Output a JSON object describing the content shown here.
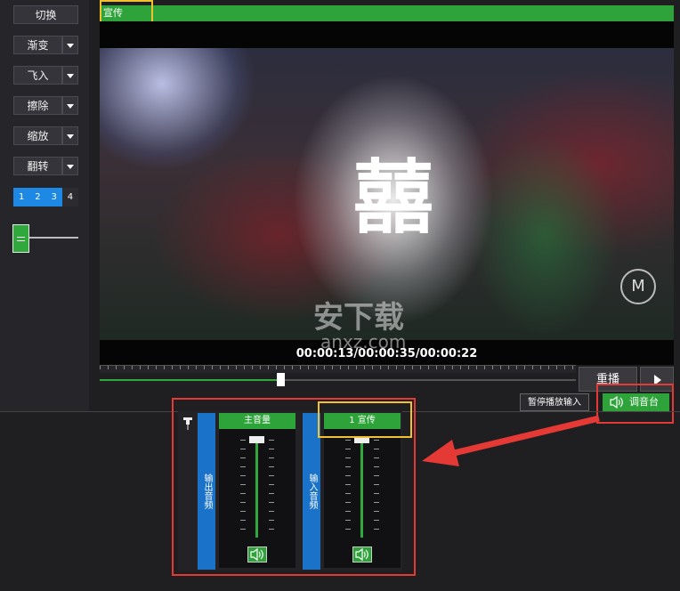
{
  "left_toolbar": {
    "switch_label": "切换",
    "fade_label": "渐变",
    "fly_in_label": "飞入",
    "wipe_label": "擦除",
    "zoom_label": "缩放",
    "flip_label": "翻转",
    "layers": [
      "1",
      "2",
      "3",
      "4"
    ],
    "fader_icon": "equals-icon"
  },
  "preview": {
    "channel_name": "宣传",
    "timecode": "00:00:13/00:00:35/00:00:22",
    "progress_fraction": 0.38,
    "watermark_brand": "M",
    "watermark_site": "安下载",
    "watermark_url": "anxz.com",
    "glyph": "囍"
  },
  "controls": {
    "replay_label": "重播",
    "play_icon": "play-icon",
    "pause_input_label": "暂停播放输入",
    "mixer_label": "调音台",
    "mixer_icon": "speaker-icon"
  },
  "mixer": {
    "output_label": "输出音频",
    "input_label": "输入音频",
    "master_label": "主音量",
    "input_channel_label": "1  宣传",
    "pin_icon": "pin-icon"
  },
  "colors": {
    "accent_green": "#2ea33a",
    "accent_blue": "#1a73c9",
    "highlight_red": "#e53935",
    "highlight_yellow": "#f2c12e"
  }
}
